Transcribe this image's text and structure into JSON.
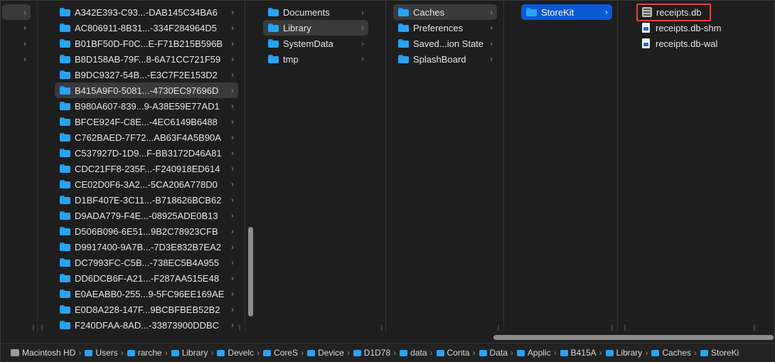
{
  "column0": {
    "items": [
      "",
      "",
      "",
      ""
    ],
    "selected_index": 0
  },
  "column1": {
    "items": [
      "A342E393-C93...-DAB145C34BA6",
      "AC806911-8B31...-334F284964D5",
      "B01BF50D-F0C...E-F71B215B596B",
      "B8D158AB-79F...8-6A71CC721F59",
      "B9DC9327-54B...-E3C7F2E153D2",
      "B415A9F0-5081...-4730EC97696D",
      "B980A607-839...9-A38E59E77AD1",
      "BFCE924F-C8E...-4EC6149B6488",
      "C762BAED-7F72...AB63F4A5B90A",
      "C537927D-1D9...F-BB3172D46A81",
      "CDC21FF8-235F...-F240918ED614",
      "CE02D0F6-3A2...-5CA206A778D0",
      "D1BF407E-3C11...-B718626BCB62",
      "D9ADA779-F4E...-08925ADE0B13",
      "D506B096-6E51...9B2C78923CFB",
      "D9917400-9A7B...-7D3E832B7EA2",
      "DC7993FC-C5B...-738EC5B4A955",
      "DD6DCB6F-A21...-F287AA515E48",
      "E0AEABB0-255...9-5FC96EE169AE",
      "E0D8A228-147F...9BCBFBEB52B2",
      "F240DFAA-8AD...-33873900DDBC"
    ],
    "selected_index": 5
  },
  "column2": {
    "items": [
      "Documents",
      "Library",
      "SystemData",
      "tmp"
    ],
    "selected_index": 1
  },
  "column3": {
    "items": [
      "Caches",
      "Preferences",
      "Saved...ion State",
      "SplashBoard"
    ],
    "selected_index": 0
  },
  "column4": {
    "items": [
      "StoreKit"
    ],
    "selected_index": 0
  },
  "column5": {
    "items": [
      {
        "label": "receipts.db",
        "icon": "database-file-icon"
      },
      {
        "label": "receipts.db-shm",
        "icon": "document-icon"
      },
      {
        "label": "receipts.db-wal",
        "icon": "document-icon"
      }
    ],
    "highlighted_index": 0,
    "highlight_color": "#e0443e"
  },
  "pathbar": {
    "crumbs": [
      {
        "label": "Macintosh HD",
        "icon": "hard-drive-icon"
      },
      {
        "label": "Users",
        "icon": "folder-icon"
      },
      {
        "label": "rarche",
        "icon": "folder-icon"
      },
      {
        "label": "Library",
        "icon": "folder-icon"
      },
      {
        "label": "Develc",
        "icon": "folder-icon"
      },
      {
        "label": "CoreS",
        "icon": "folder-icon"
      },
      {
        "label": "Device",
        "icon": "folder-icon"
      },
      {
        "label": "D1D78",
        "icon": "folder-icon"
      },
      {
        "label": "data",
        "icon": "folder-icon"
      },
      {
        "label": "Conta",
        "icon": "folder-icon"
      },
      {
        "label": "Data",
        "icon": "folder-icon"
      },
      {
        "label": "Applic",
        "icon": "folder-icon"
      },
      {
        "label": "B415A",
        "icon": "folder-icon"
      },
      {
        "label": "Library",
        "icon": "folder-icon"
      },
      {
        "label": "Caches",
        "icon": "folder-icon"
      },
      {
        "label": "StoreKi",
        "icon": "folder-icon"
      }
    ]
  },
  "colors": {
    "selection_blue": "#0a5ad4",
    "selection_gray": "#3a3a3c",
    "folder_blue": "#29a3f1",
    "background": "#1e1e1e"
  }
}
